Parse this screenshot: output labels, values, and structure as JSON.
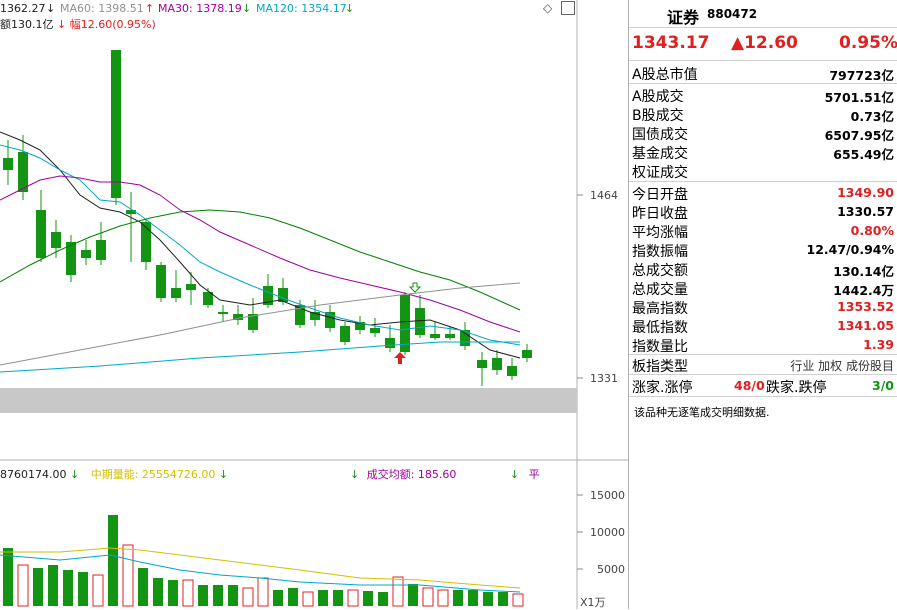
{
  "legend_top": {
    "ma5_partial": "1362.27",
    "ma60": "MA60: 1398.51",
    "ma30": "MA30: 1378.19",
    "ma120": "MA120: 1354.17",
    "line2_a": "额130.1亿",
    "line2_b": "幅12.60(0.95%)"
  },
  "price_axis": {
    "upper": "1464",
    "lower": "1331"
  },
  "legend_volume": {
    "item1": "8760174.00",
    "item2": "中期量能: 25554726.00",
    "item3": "成交均额: 185.60",
    "item4": "平"
  },
  "volume_axis": {
    "t15000": "15000",
    "t10000": "10000",
    "t5000": "5000",
    "unit": "X1万"
  },
  "panel": {
    "name": "证券",
    "code": "880472",
    "price": "1343.17",
    "change": "▲12.60",
    "pct": "0.95%",
    "market_cap_label": "A股总市值",
    "market_cap_value": "797723亿",
    "turnover_rows": [
      {
        "label": "A股成交",
        "value": "5701.51亿"
      },
      {
        "label": "B股成交",
        "value": "0.73亿"
      },
      {
        "label": "国债成交",
        "value": "6507.95亿"
      },
      {
        "label": "基金成交",
        "value": "655.49亿"
      },
      {
        "label": "权证成交",
        "value": ""
      }
    ],
    "stats": [
      {
        "label": "今日开盘",
        "value": "1349.90",
        "color": "red"
      },
      {
        "label": "昨日收盘",
        "value": "1330.57",
        "color": "black"
      },
      {
        "label": "平均涨幅",
        "value": "0.80%",
        "color": "red"
      },
      {
        "label": "指数振幅",
        "value": "12.47/0.94%",
        "color": "black"
      },
      {
        "label": "总成交额",
        "value": "130.14亿",
        "color": "black"
      },
      {
        "label": "总成交量",
        "value": "1442.4万",
        "color": "black"
      },
      {
        "label": "最高指数",
        "value": "1353.52",
        "color": "red"
      },
      {
        "label": "最低指数",
        "value": "1341.05",
        "color": "red"
      },
      {
        "label": "指数量比",
        "value": "1.39",
        "color": "red"
      }
    ],
    "type_label": "板指类型",
    "type_value": "行业 加权 成份股目",
    "updown_label": "涨家.涨停",
    "updown_value": "48/0",
    "down_label": "跌家.跌停",
    "down_value": "3/0",
    "note": "该品种无逐笔成交明细数据."
  },
  "chart_data": {
    "type": "candlestick",
    "price_ticks": [
      1464,
      1331
    ],
    "volume_ticks": [
      15000,
      10000,
      5000
    ],
    "volume_unit": "X1万"
  },
  "colors": {
    "up": "#e02020",
    "down": "#139413",
    "ma_white": "#202020",
    "ma_blue": "#00a8c8",
    "ma_purple": "#a000a0",
    "ma_green": "#008000",
    "ma_gray": "#909090",
    "band": "#c8c8c8"
  }
}
